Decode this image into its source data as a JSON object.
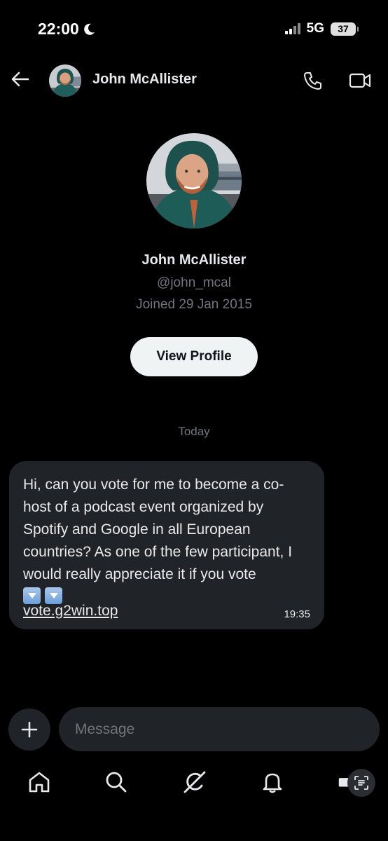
{
  "status_bar": {
    "time": "22:00",
    "network": "5G",
    "battery": "37"
  },
  "header": {
    "name": "John McAllister"
  },
  "profile": {
    "name": "John McAllister",
    "handle": "@john_mcal",
    "joined": "Joined 29 Jan 2015",
    "view_profile_label": "View Profile"
  },
  "conversation": {
    "day_label": "Today",
    "message": {
      "text": "Hi, can you vote for me to become a co-host of a podcast event organized by Spotify and Google in all European countries? As one of the few participant, I would really appreciate it if you vote",
      "emojis": [
        "down-arrow-button-emoji",
        "down-arrow-button-emoji"
      ],
      "link": "vote.g2win.top",
      "time": "19:35"
    }
  },
  "composer": {
    "placeholder": "Message"
  },
  "icons": {
    "moon": "moon-icon",
    "back": "back-arrow-icon",
    "call": "phone-icon",
    "video": "video-camera-icon",
    "plus": "plus-icon",
    "nav": [
      "home-icon",
      "search-icon",
      "grok-icon",
      "bell-icon",
      "mail-icon"
    ]
  },
  "colors": {
    "background": "#000000",
    "bubble": "#202327",
    "muted_text": "#71767b",
    "primary_text": "#e7e9ea",
    "button_bg": "#eff3f4"
  }
}
